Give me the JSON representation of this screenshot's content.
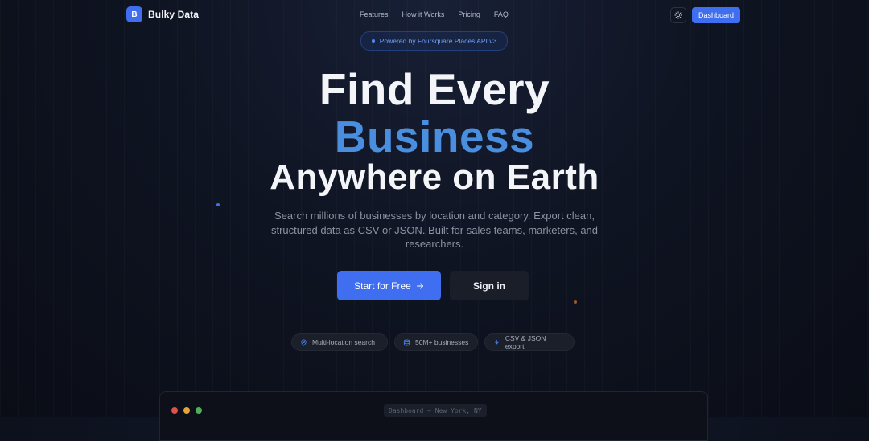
{
  "nav": {
    "logo_letter": "B",
    "brand": "Bulky Data",
    "links": [
      "Features",
      "How it Works",
      "Pricing",
      "FAQ"
    ],
    "theme_icon": "sun-icon",
    "dashboard_label": "Dashboard"
  },
  "badge": {
    "text": "Powered by Foursquare Places API v3"
  },
  "hero": {
    "line1": "Find Every",
    "line2": "Business",
    "line3": "Anywhere on Earth",
    "subtitle": "Search millions of businesses by location and category. Export clean, structured data as CSV or JSON. Built for sales teams, marketers, and researchers."
  },
  "cta": {
    "primary_label": "Start for Free",
    "primary_icon": "arrow-right-icon",
    "secondary_label": "Sign in"
  },
  "features": [
    {
      "icon": "map-pin-icon",
      "label": "Multi-location search"
    },
    {
      "icon": "database-icon",
      "label": "50M+ businesses"
    },
    {
      "icon": "download-icon",
      "label": "CSV & JSON export"
    }
  ],
  "preview": {
    "title": "Dashboard — New York, NY"
  },
  "colors": {
    "accent": "#3f6ff0",
    "headline_blue": "#4a8ee0",
    "background": "#0f1422"
  }
}
